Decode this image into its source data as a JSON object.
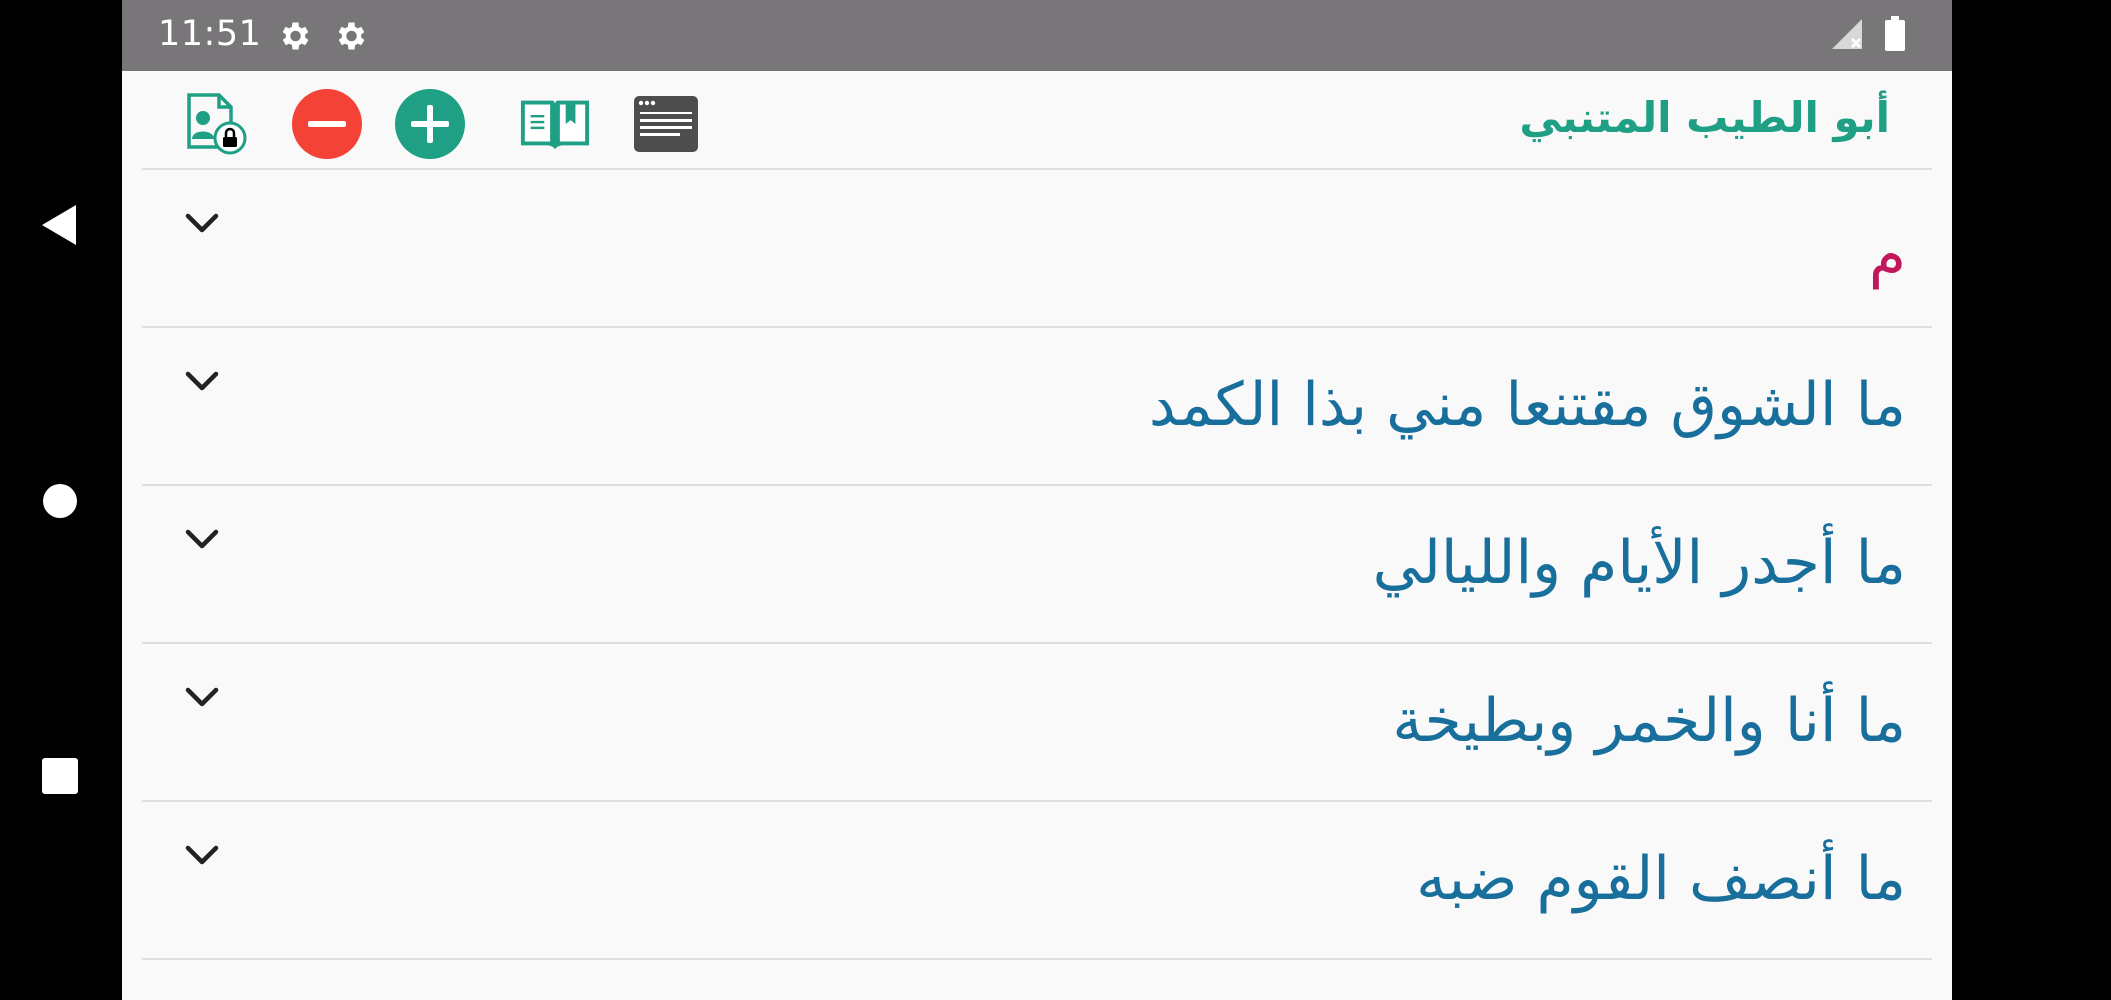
{
  "status_bar": {
    "time": "11:51",
    "icons": [
      "gear-icon",
      "gear-icon",
      "signal-off-icon",
      "battery-icon"
    ]
  },
  "toolbar": {
    "title": "أبو الطيب المتنبي",
    "icons": [
      "private-account-icon",
      "zoom-out-icon",
      "zoom-in-icon",
      "book-icon",
      "browser-window-icon"
    ]
  },
  "list": {
    "items": [
      {
        "label": "م"
      },
      {
        "label": "ما الشوق مقتنعا مني بذا الكمد"
      },
      {
        "label": "ما أجدر الأيام والليالي"
      },
      {
        "label": "ما أنا والخمر وبطيخة"
      },
      {
        "label": "ما أنصف القوم ضبه"
      }
    ]
  },
  "colors": {
    "status_bar": "#787679",
    "accent_green": "#1f9f84",
    "remove_red": "#f44336",
    "title_text": "#196f9c",
    "letter_text": "#c2185b"
  }
}
